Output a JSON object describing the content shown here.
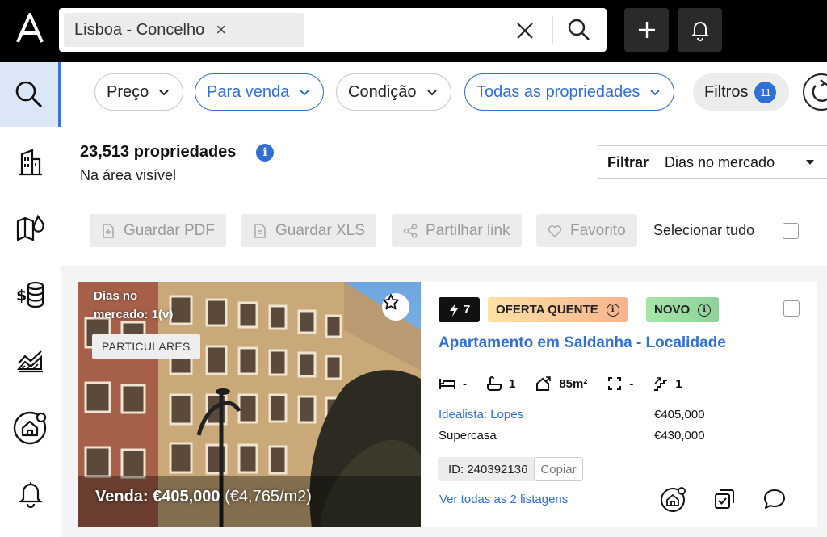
{
  "search": {
    "chip_label": "Lisboa - Concelho"
  },
  "filters": {
    "price": "Preço",
    "sale": "Para venda",
    "condition": "Condição",
    "property_types": "Todas as propriedades",
    "more": "Filtros",
    "more_count": "11"
  },
  "results": {
    "count": "23,513 propriedades",
    "area": "Na área visível",
    "sort_label": "Filtrar",
    "sort_value": "Dias no mercado"
  },
  "actions": {
    "pdf": "Guardar PDF",
    "xls": "Guardar XLS",
    "share": "Partilhar link",
    "favorite": "Favorito",
    "select_all": "Selecionar tudo"
  },
  "listing": {
    "days_on_market": "Dias no mercado: 1(v)",
    "seller_type": "PARTICULARES",
    "price_label": "Venda: €405,000",
    "price_per_m2": "(€4,765/m2)",
    "score": "7",
    "hot_tag": "OFERTA QUENTE",
    "new_tag": "NOVO",
    "title": "Apartamento em Saldanha - Localidade",
    "bedrooms": "-",
    "bathrooms": "1",
    "area": "85m²",
    "plot": "-",
    "floor": "1",
    "source1_name": "Idealista: Lopes",
    "source1_price": "€405,000",
    "source2_name": "Supercasa",
    "source2_price": "€430,000",
    "id": "ID: 240392136",
    "copy": "Copiar",
    "all_listings": "Ver todas as 2 listagens"
  }
}
